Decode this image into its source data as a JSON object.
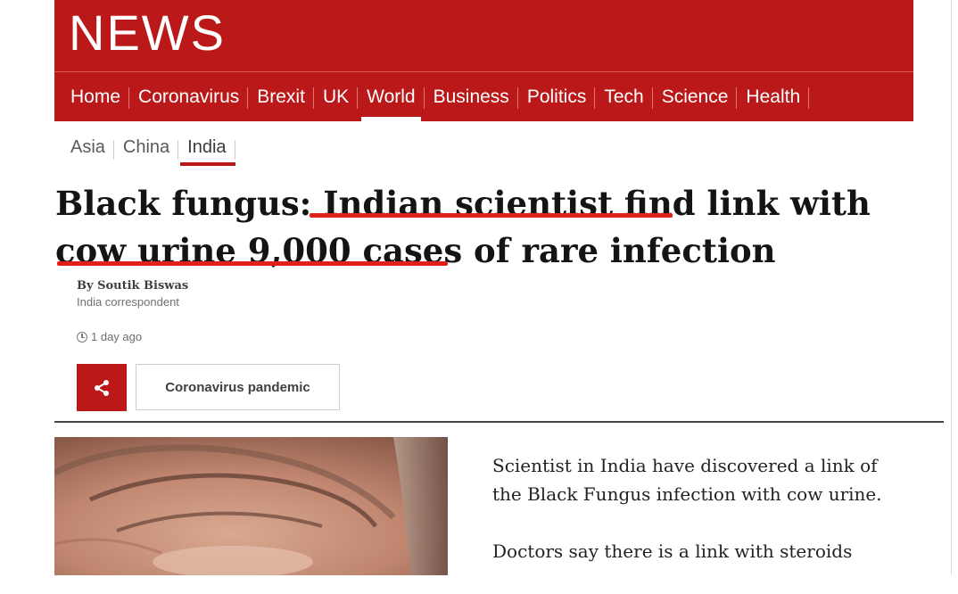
{
  "header": {
    "logo": "NEWS",
    "nav": [
      {
        "label": "Home"
      },
      {
        "label": "Coronavirus"
      },
      {
        "label": "Brexit"
      },
      {
        "label": "UK"
      },
      {
        "label": "World"
      },
      {
        "label": "Business"
      },
      {
        "label": "Politics"
      },
      {
        "label": "Tech"
      },
      {
        "label": "Science"
      },
      {
        "label": "Health"
      }
    ],
    "active_nav": "World",
    "brand_color": "#bb1919"
  },
  "subnav": {
    "items": [
      {
        "label": "Asia"
      },
      {
        "label": "China"
      },
      {
        "label": "India"
      }
    ],
    "active": "India"
  },
  "article": {
    "headline_parts": [
      "Black fungus: ",
      "Indian scientist find",
      " link with ",
      "cow urine 9,000 cases",
      " of rare infection"
    ],
    "author": "By Soutik Biswas",
    "author_role": "India correspondent",
    "timestamp": "1 day ago",
    "topic_tag": "Coronavirus pandemic",
    "body_paragraphs": [
      "Scientist in India have discovered a link of the Black Fungus infection with cow urine.",
      "Doctors say there is a link with steroids"
    ],
    "annotation_color": "#e0201c"
  },
  "icons": {
    "share": "share-icon",
    "clock": "clock-icon"
  }
}
